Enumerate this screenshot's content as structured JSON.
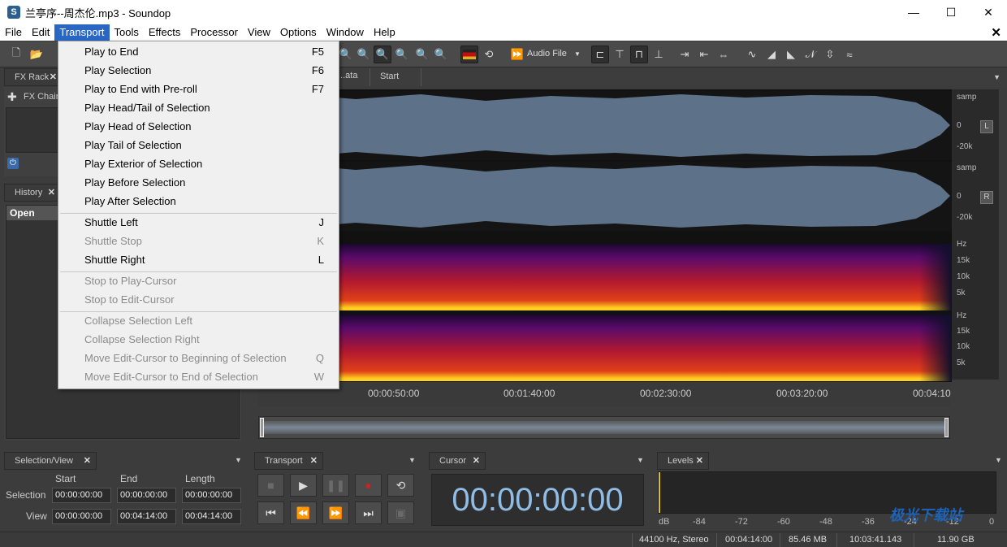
{
  "window": {
    "title": "兰亭序--周杰伦.mp3 - Soundop",
    "app_icon_letter": "S",
    "minimize": "—",
    "maximize": "☐",
    "close": "✕"
  },
  "menubar": {
    "items": [
      "File",
      "Edit",
      "Transport",
      "Tools",
      "Effects",
      "Processor",
      "View",
      "Options",
      "Window",
      "Help"
    ],
    "active": "Transport",
    "close_doc": "✕"
  },
  "toolbar": {
    "audio_file_label": "Audio File"
  },
  "fx_rack": {
    "tab": "FX Rack",
    "chain_label": "FX Chain"
  },
  "history": {
    "tab": "History",
    "items": [
      "Open"
    ]
  },
  "editor_tabs": {
    "tabs": [
      "...ata",
      "Start"
    ]
  },
  "waveform": {
    "left_channel": {
      "labels": [
        "samp",
        "0",
        "-20k"
      ],
      "button": "L"
    },
    "right_channel": {
      "labels": [
        "samp",
        "0",
        "-20k"
      ],
      "button": "R"
    },
    "spectrum_labels": [
      "Hz",
      "15k",
      "10k",
      "5k"
    ]
  },
  "timeline": {
    "ticks": [
      "00:00:50:00",
      "00:01:40:00",
      "00:02:30:00",
      "00:03:20:00",
      "00:04:10"
    ]
  },
  "selection_view": {
    "tab": "Selection/View",
    "headers": [
      "Start",
      "End",
      "Length"
    ],
    "rows": [
      {
        "label": "Selection",
        "start": "00:00:00:00",
        "end": "00:00:00:00",
        "length": "00:00:00:00"
      },
      {
        "label": "View",
        "start": "00:00:00:00",
        "end": "00:04:14:00",
        "length": "00:04:14:00"
      }
    ]
  },
  "transport_panel": {
    "tab": "Transport"
  },
  "cursor_panel": {
    "tab": "Cursor",
    "value": "00:00:00:00"
  },
  "levels_panel": {
    "tab": "Levels",
    "scale": [
      "dB",
      "-84",
      "-72",
      "-60",
      "-48",
      "-36",
      "-24",
      "-12",
      "0"
    ]
  },
  "statusbar": {
    "format": "44100 Hz, Stereo",
    "duration": "00:04:14:00",
    "size": "85.46 MB",
    "time": "10:03:41.143",
    "free": "11.90 GB"
  },
  "transport_menu": {
    "groups": [
      [
        {
          "label": "Play to End",
          "shortcut": "F5",
          "enabled": true
        },
        {
          "label": "Play Selection",
          "shortcut": "F6",
          "enabled": true
        },
        {
          "label": "Play to End with Pre-roll",
          "shortcut": "F7",
          "enabled": true
        },
        {
          "label": "Play Head/Tail of Selection",
          "shortcut": "",
          "enabled": true
        },
        {
          "label": "Play Head of Selection",
          "shortcut": "",
          "enabled": true
        },
        {
          "label": "Play Tail of Selection",
          "shortcut": "",
          "enabled": true
        },
        {
          "label": "Play Exterior of Selection",
          "shortcut": "",
          "enabled": true
        },
        {
          "label": "Play Before Selection",
          "shortcut": "",
          "enabled": true
        },
        {
          "label": "Play After Selection",
          "shortcut": "",
          "enabled": true
        }
      ],
      [
        {
          "label": "Shuttle Left",
          "shortcut": "J",
          "enabled": true
        },
        {
          "label": "Shuttle Stop",
          "shortcut": "K",
          "enabled": false
        },
        {
          "label": "Shuttle Right",
          "shortcut": "L",
          "enabled": true
        }
      ],
      [
        {
          "label": "Stop to Play-Cursor",
          "shortcut": "",
          "enabled": false
        },
        {
          "label": "Stop to Edit-Cursor",
          "shortcut": "",
          "enabled": false
        }
      ],
      [
        {
          "label": "Collapse Selection Left",
          "shortcut": "",
          "enabled": false
        },
        {
          "label": "Collapse Selection Right",
          "shortcut": "",
          "enabled": false
        },
        {
          "label": "Move Edit-Cursor to Beginning of Selection",
          "shortcut": "Q",
          "enabled": false
        },
        {
          "label": "Move Edit-Cursor to End of Selection",
          "shortcut": "W",
          "enabled": false
        }
      ]
    ]
  },
  "watermark": "极光下载站",
  "colors": {
    "waveform": "#5d7188",
    "menu_highlight": "#2a67c4",
    "cursor_text": "#8fbde6",
    "record": "#d02020"
  }
}
